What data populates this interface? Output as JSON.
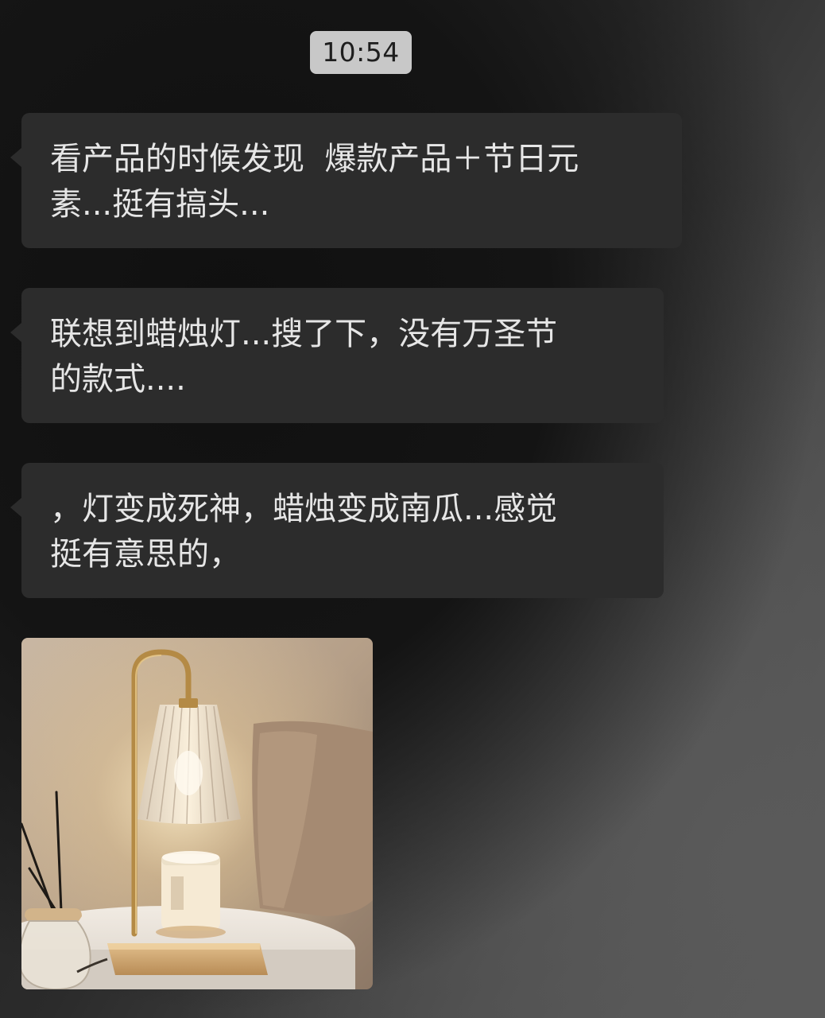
{
  "chat": {
    "timestamp": "10:54",
    "messages": [
      {
        "type": "text",
        "text": "看产品的时候发现  爆款产品＋节日元\n素...挺有搞头..."
      },
      {
        "type": "text",
        "text": "联想到蜡烛灯...搜了下，没有万圣节\n的款式...."
      },
      {
        "type": "text",
        "text": "，灯变成死神，蜡烛变成南瓜...感觉\n挺有意思的，"
      },
      {
        "type": "image",
        "image_content": "candle-warmer-lamp-photo"
      }
    ]
  },
  "colors": {
    "bubble_background": "#2c2c2c",
    "bubble_text": "#e6e6e6",
    "timestamp_background": "#c8c8c8",
    "timestamp_text": "#1e1e1e"
  }
}
